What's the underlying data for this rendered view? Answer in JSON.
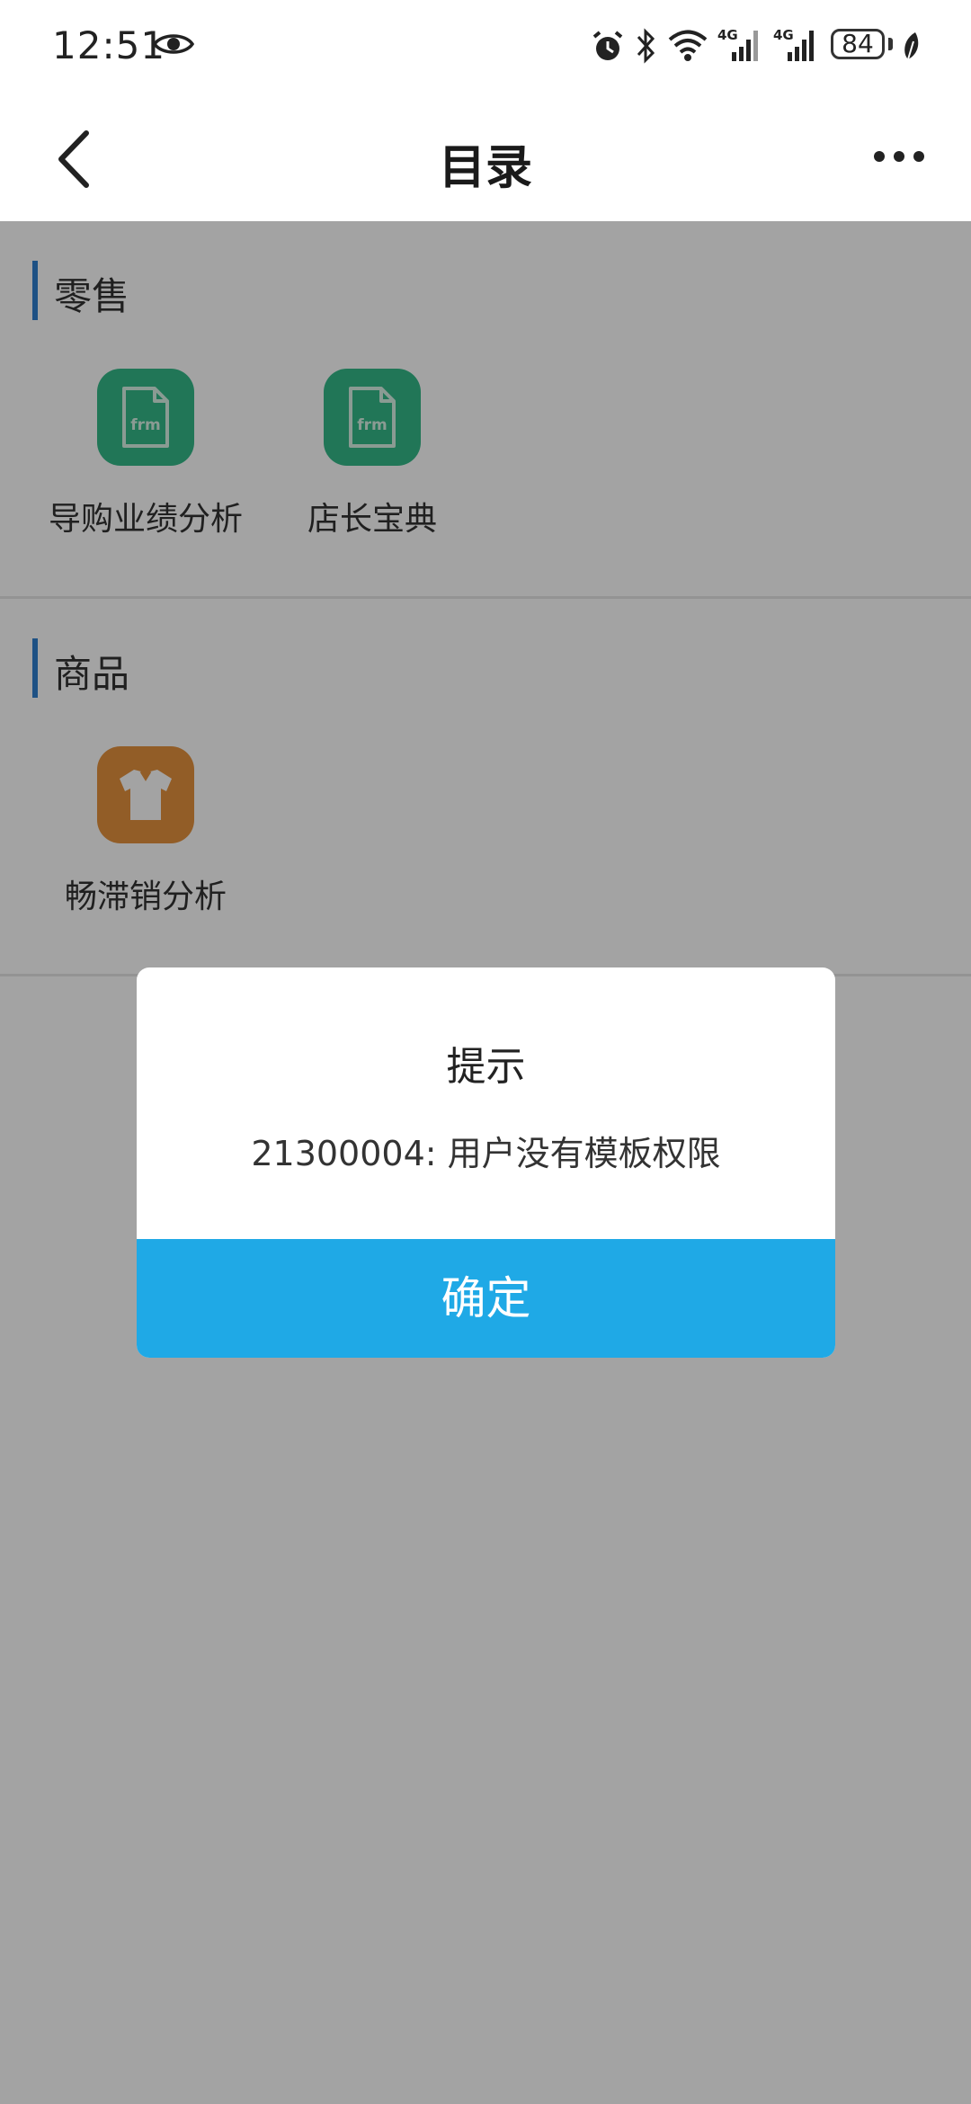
{
  "status_bar": {
    "time": "12:51",
    "battery": "84",
    "icons": [
      "eye-icon",
      "alarm-icon",
      "bluetooth-icon",
      "wifi-icon",
      "signal-4g-icon",
      "signal-4g-icon",
      "battery-icon",
      "leaf-icon"
    ]
  },
  "nav": {
    "title": "目录",
    "back_icon": "chevron-left-icon",
    "more_icon": "more-horizontal-icon"
  },
  "sections": [
    {
      "title": "零售",
      "items": [
        {
          "label": "导购业绩分析",
          "icon": "frm-file-icon",
          "color": "#34b988"
        },
        {
          "label": "店长宝典",
          "icon": "frm-file-icon",
          "color": "#34b988"
        }
      ]
    },
    {
      "title": "商品",
      "items": [
        {
          "label": "畅滞销分析",
          "icon": "shirt-icon",
          "color": "#e5923e"
        }
      ]
    }
  ],
  "dialog": {
    "title": "提示",
    "message": "21300004: 用户没有模板权限",
    "confirm_label": "确定",
    "confirm_color": "#1fa9e6"
  },
  "frm_label": "frm",
  "colors": {
    "accent": "#2f7fcf",
    "overlay": "rgba(0,0,0,0.36)"
  }
}
